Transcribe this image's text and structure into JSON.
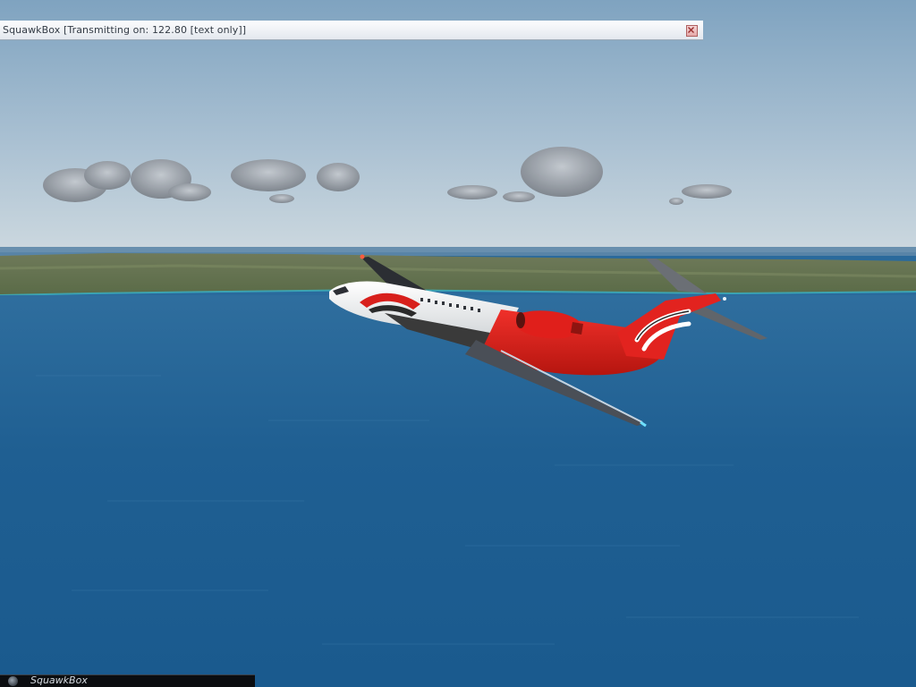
{
  "squawkbox_window": {
    "title": "SquawkBox [Transmitting on: 122.80 [text only]]",
    "close_icon": "close-icon"
  },
  "taskbar": {
    "label": "SquawkBox",
    "icon": "squawkbox-app-icon"
  },
  "aircraft": {
    "tail_logo": "chevron-swoosh-logo"
  },
  "colors": {
    "sky_top": "#87a9c4",
    "sky_horizon": "#c9d6df",
    "sea": "#1f5f93",
    "livery_red": "#e2231f",
    "livery_white": "#f2f2f2",
    "livery_dark": "#3a3a3a",
    "window_bg": "#eef1f5",
    "close_button": "#e6a9a9"
  }
}
